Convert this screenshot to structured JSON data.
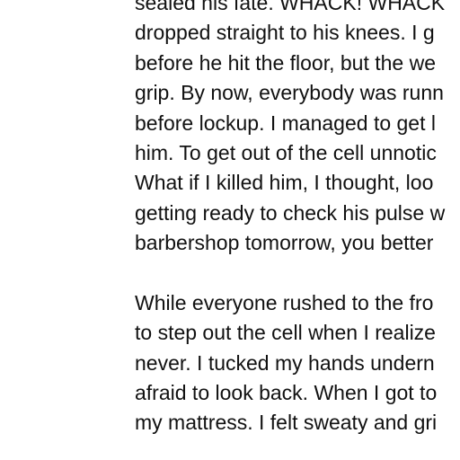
{
  "document": {
    "paragraph1": [
      "sealed his fate. WHACK! WHACK",
      "dropped straight to his knees. I g",
      "before he hit the floor, but the we",
      "grip. By now, everybody was runn",
      "before lockup. I managed to get l",
      "him. To get out of the cell unnotic",
      "What if I killed him, I thought, loo",
      "getting ready to check his pulse w",
      "barbershop tomorrow, you better"
    ],
    "paragraph2": [
      "While everyone rushed to the fro",
      "to step out the cell when I realize",
      "never. I tucked my hands undern",
      "afraid to look back. When I got to",
      "my mattress. I felt sweaty and gri"
    ]
  }
}
